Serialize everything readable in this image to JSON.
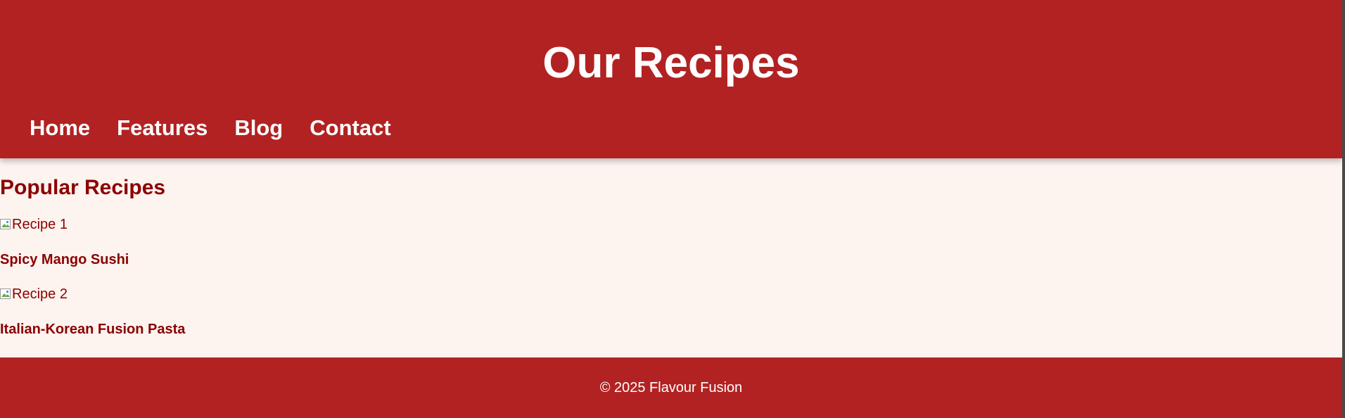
{
  "header": {
    "title": "Our Recipes",
    "nav": [
      {
        "label": "Home"
      },
      {
        "label": "Features"
      },
      {
        "label": "Blog"
      },
      {
        "label": "Contact"
      }
    ]
  },
  "main": {
    "section_title": "Popular Recipes",
    "recipes": [
      {
        "image_alt": "Recipe 1",
        "name": "Spicy Mango Sushi",
        "image_icon": "broken-image-icon"
      },
      {
        "image_alt": "Recipe 2",
        "name": "Italian-Korean Fusion Pasta",
        "image_icon": "broken-image-icon"
      }
    ]
  },
  "footer": {
    "text": "© 2025 Flavour Fusion"
  },
  "colors": {
    "header_bg": "#b22222",
    "page_bg": "#fdf3ef",
    "accent_text": "#8b0000",
    "light_text": "#ffffff"
  }
}
